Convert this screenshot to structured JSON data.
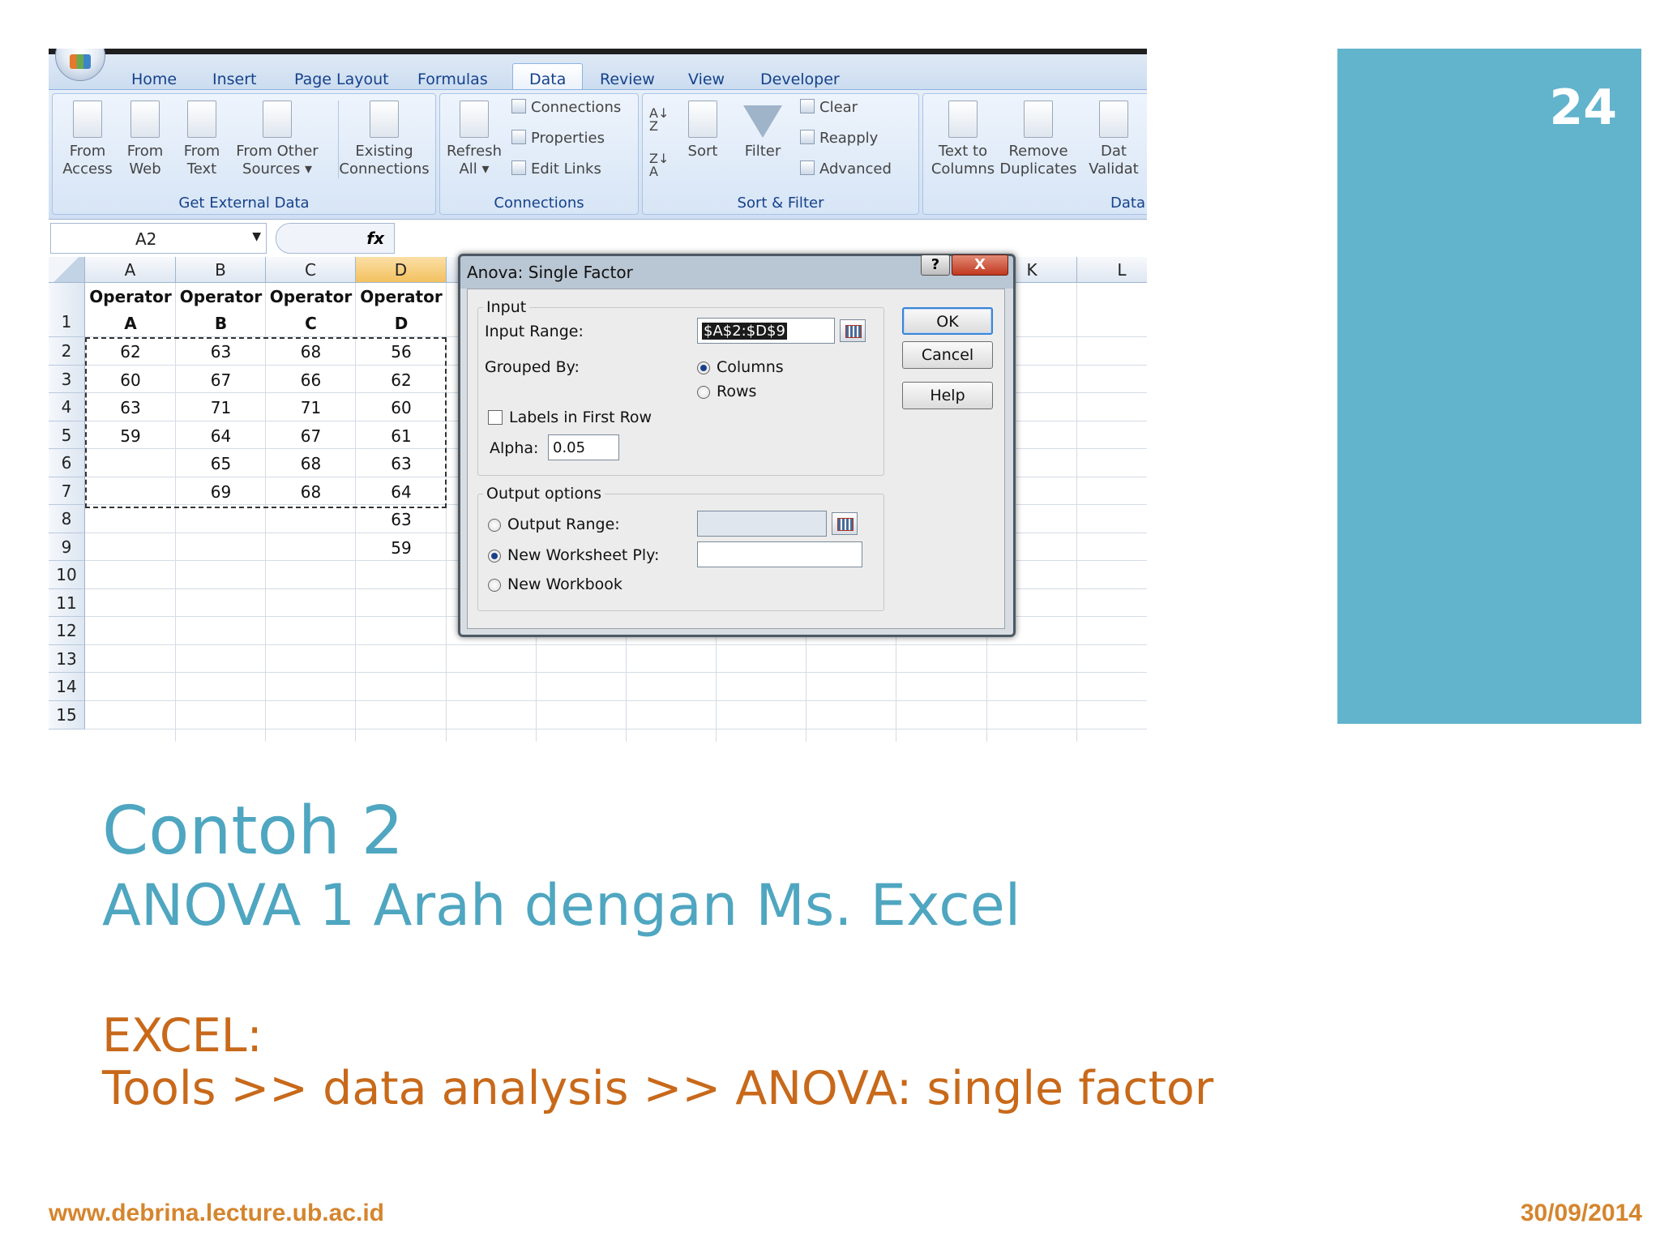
{
  "slide": {
    "number": "24",
    "title": "Contoh 2",
    "subtitle": "ANOVA 1 Arah dengan Ms. Excel",
    "excel_label": "EXCEL:",
    "excel_path": "Tools >> data analysis >> ANOVA: single factor",
    "footer_url": "www.debrina.lecture.ub.ac.id",
    "footer_date": "30/09/2014",
    "colors": {
      "accent": "#62b3cc",
      "title": "#4fa6c0",
      "body": "#c8691a",
      "footer": "#d5852e"
    }
  },
  "excel": {
    "tabs": [
      "Home",
      "Insert",
      "Page Layout",
      "Formulas",
      "Data",
      "Review",
      "View",
      "Developer"
    ],
    "active_tab": "Data",
    "ribbon": {
      "get_external_data": {
        "label": "Get External Data",
        "buttons": [
          {
            "l1": "From",
            "l2": "Access",
            "icon": "access-db-icon"
          },
          {
            "l1": "From",
            "l2": "Web",
            "icon": "web-globe-icon"
          },
          {
            "l1": "From",
            "l2": "Text",
            "icon": "text-file-icon"
          },
          {
            "l1": "From Other",
            "l2": "Sources ▾",
            "icon": "other-sources-icon"
          },
          {
            "l1": "Existing",
            "l2": "Connections",
            "icon": "existing-connections-icon"
          }
        ]
      },
      "connections": {
        "label": "Connections",
        "refresh": {
          "l1": "Refresh",
          "l2": "All ▾"
        },
        "small": [
          "Connections",
          "Properties",
          "Edit Links"
        ]
      },
      "sort_filter": {
        "label": "Sort & Filter",
        "sort": "Sort",
        "filter": "Filter",
        "small": [
          "Clear",
          "Reapply",
          "Advanced"
        ]
      },
      "data_tools": {
        "label": "Data",
        "buttons": [
          {
            "l1": "Text to",
            "l2": "Columns"
          },
          {
            "l1": "Remove",
            "l2": "Duplicates"
          },
          {
            "l1": "Dat",
            "l2": "Validat"
          }
        ]
      }
    },
    "name_box": "A2",
    "fx_label": "fx",
    "columns": [
      "A",
      "B",
      "C",
      "D",
      "K",
      "L"
    ],
    "rows": [
      "1",
      "2",
      "3",
      "4",
      "5",
      "6",
      "7",
      "8",
      "9",
      "10",
      "11",
      "12",
      "13",
      "14",
      "15"
    ],
    "headers": [
      {
        "l1": "Operator",
        "l2": "A"
      },
      {
        "l1": "Operator",
        "l2": "B"
      },
      {
        "l1": "Operator",
        "l2": "C"
      },
      {
        "l1": "Operator",
        "l2": "D"
      }
    ],
    "data": {
      "A": [
        "62",
        "60",
        "63",
        "59",
        "",
        "",
        "",
        ""
      ],
      "B": [
        "63",
        "67",
        "71",
        "64",
        "65",
        "69",
        "",
        ""
      ],
      "C": [
        "68",
        "66",
        "71",
        "67",
        "68",
        "68",
        "",
        ""
      ],
      "D": [
        "56",
        "62",
        "60",
        "61",
        "63",
        "64",
        "63",
        "59"
      ]
    }
  },
  "dialog": {
    "title": "Anova: Single Factor",
    "help_glyph": "?",
    "close_glyph": "X",
    "input_legend": "Input",
    "input_range_label": "Input Range:",
    "input_range_value": "$A$2:$D$9",
    "grouped_by_label": "Grouped By:",
    "columns_label": "Columns",
    "rows_label": "Rows",
    "grouped_by_selected": "Columns",
    "labels_first_row_label": "Labels in First Row",
    "labels_first_row_checked": false,
    "alpha_label": "Alpha:",
    "alpha_value": "0.05",
    "output_legend": "Output options",
    "output_range_label": "Output Range:",
    "output_range_value": "",
    "new_ply_label": "New Worksheet Ply:",
    "new_ply_value": "",
    "new_workbook_label": "New Workbook",
    "output_selected": "New Worksheet Ply",
    "ok": "OK",
    "cancel": "Cancel",
    "help": "Help"
  }
}
